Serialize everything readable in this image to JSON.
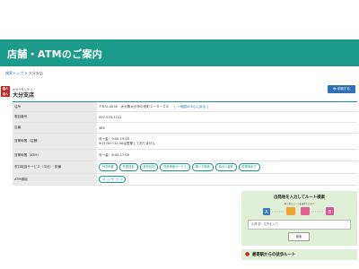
{
  "page": {
    "title": "店舗・ATMのご案内"
  },
  "breadcrumb": {
    "home": "検索トップ",
    "separator": " > ",
    "current": "大分支店"
  },
  "branch": {
    "badge": "個人\n法人",
    "kana": "オオイタシテン",
    "name": "大分支店",
    "print_label": "印刷する"
  },
  "info_rows": {
    "address": {
      "label": "住所",
      "value": "〒870-0035　大分県大分市中央町２－９－２６",
      "map_link": "[ ＞地図の中心に戻る ]"
    },
    "phone": {
      "label": "電話番号",
      "value": "097-534-1211"
    },
    "store_no": {
      "label": "店番",
      "value": "385"
    },
    "hours": {
      "label": "営業時間（店舗）",
      "line1": "月～金：9:00-15:00",
      "line2": "※11:30～12:30は営業しておりません"
    },
    "atm_hours": {
      "label": "営業時間（ATM）",
      "value": "月～金：8:45-17:00"
    },
    "services": {
      "label": "窓口取扱サービス（平日）・設備",
      "chips": [
        "外貨両替",
        "外国送金",
        "投資信託",
        "資産承継サービス",
        "車いす関係",
        "障がい者等",
        "駐車場あり"
      ]
    },
    "atm_services": {
      "label": "ATM機能",
      "chips": [
        "ほしいサービス"
      ]
    }
  },
  "route_search": {
    "title": "出発地を入力してルート検索",
    "subtitle": "乗り換えルートを検索できます",
    "placeholder": "出発 駅・住所を入力",
    "button": "検索"
  },
  "nearby": {
    "label": "最寄駅からの徒歩ルート"
  },
  "colors": {
    "brand": "#1d9b8a",
    "badge_red": "#c62828",
    "print_blue": "#2d72b6",
    "route_bg": "#dff0d6"
  },
  "icons": {
    "print": "printer-icon",
    "pin": "map-pin-icon",
    "route": "route-illustration"
  }
}
